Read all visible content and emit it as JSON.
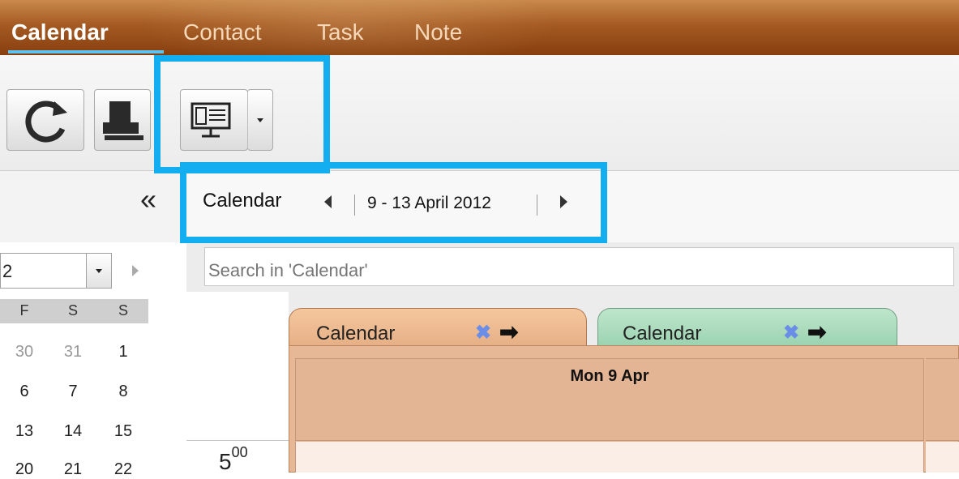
{
  "nav": {
    "tabs": [
      "Calendar",
      "Contact",
      "Task",
      "Note"
    ]
  },
  "colors": {
    "accent_highlight": "#12aef0",
    "calendar_1_tab": "#e7b087",
    "calendar_2_tab": "#9cd3b1",
    "topbar": "#a55a22"
  },
  "toolbar": {
    "icons": [
      "refresh-icon",
      "print-icon",
      "layout-icon",
      "chevron-down-icon"
    ]
  },
  "navigation": {
    "folder_label": "Calendar",
    "date_range": "9 - 13 April 2012"
  },
  "search": {
    "placeholder": "Search in 'Calendar'"
  },
  "mini_calendar": {
    "month_value": "2",
    "day_headers": [
      "F",
      "S",
      "S"
    ],
    "rows": [
      {
        "days": [
          "30",
          "31",
          "1"
        ],
        "other_month": [
          true,
          true,
          false
        ]
      },
      {
        "days": [
          "6",
          "7",
          "8"
        ],
        "other_month": [
          false,
          false,
          false
        ]
      },
      {
        "days": [
          "13",
          "14",
          "15"
        ],
        "other_month": [
          false,
          false,
          false
        ]
      },
      {
        "days": [
          "20",
          "21",
          "22"
        ],
        "other_month": [
          false,
          false,
          false
        ]
      }
    ]
  },
  "calendars": [
    {
      "label": "Calendar",
      "remove_icon": "x-icon",
      "move_icon": "arrow-right-icon"
    },
    {
      "label": "Calendar",
      "remove_icon": "x-icon",
      "move_icon": "arrow-right-icon"
    }
  ],
  "day_view": {
    "day_header": "Mon 9 Apr",
    "time_hour": "5",
    "time_minutes": "00"
  }
}
